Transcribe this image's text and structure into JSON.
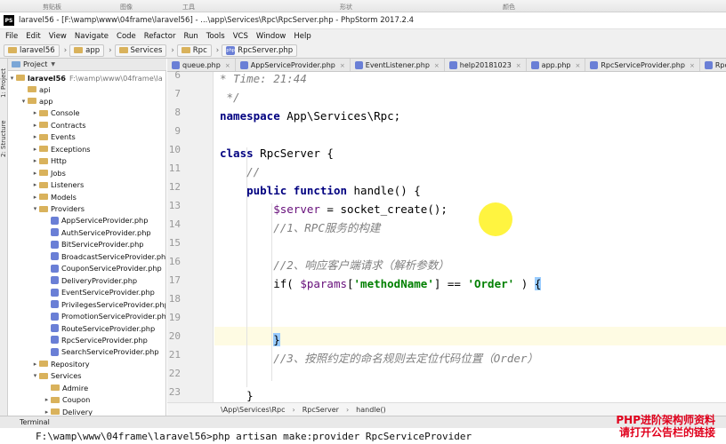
{
  "top_strip": [
    "剪贴板",
    "图像",
    "工具",
    "形状",
    "颜色"
  ],
  "window": {
    "title": "laravel56 - [F:\\wamp\\www\\04frame\\laravel56] - ...\\app\\Services\\Rpc\\RpcServer.php - PhpStorm 2017.2.4",
    "app_icon": "PS"
  },
  "menu": [
    "File",
    "Edit",
    "View",
    "Navigate",
    "Code",
    "Refactor",
    "Run",
    "Tools",
    "VCS",
    "Window",
    "Help"
  ],
  "nav": [
    "laravel56",
    "app",
    "Services",
    "Rpc",
    "RpcServer.php"
  ],
  "side_tabs": [
    "1: Project",
    "2: Structure"
  ],
  "project": {
    "header": "Project",
    "root_name": "laravel56",
    "root_path": "F:\\wamp\\www\\04frame\\la",
    "items": [
      {
        "label": "api",
        "level": 1,
        "type": "folder",
        "arrow": ""
      },
      {
        "label": "app",
        "level": 1,
        "type": "folder",
        "arrow": "▾"
      },
      {
        "label": "Console",
        "level": 2,
        "type": "folder",
        "arrow": "▸"
      },
      {
        "label": "Contracts",
        "level": 2,
        "type": "folder",
        "arrow": "▸"
      },
      {
        "label": "Events",
        "level": 2,
        "type": "folder",
        "arrow": "▸"
      },
      {
        "label": "Exceptions",
        "level": 2,
        "type": "folder",
        "arrow": "▸"
      },
      {
        "label": "Http",
        "level": 2,
        "type": "folder",
        "arrow": "▸"
      },
      {
        "label": "Jobs",
        "level": 2,
        "type": "folder",
        "arrow": "▸"
      },
      {
        "label": "Listeners",
        "level": 2,
        "type": "folder",
        "arrow": "▸"
      },
      {
        "label": "Models",
        "level": 2,
        "type": "folder",
        "arrow": "▸"
      },
      {
        "label": "Providers",
        "level": 2,
        "type": "folder",
        "arrow": "▾"
      },
      {
        "label": "AppServiceProvider.php",
        "level": 3,
        "type": "file",
        "arrow": ""
      },
      {
        "label": "AuthServiceProvider.php",
        "level": 3,
        "type": "file",
        "arrow": ""
      },
      {
        "label": "BitServiceProvider.php",
        "level": 3,
        "type": "file",
        "arrow": ""
      },
      {
        "label": "BroadcastServiceProvider.php",
        "level": 3,
        "type": "file",
        "arrow": ""
      },
      {
        "label": "CouponServiceProvider.php",
        "level": 3,
        "type": "file",
        "arrow": ""
      },
      {
        "label": "DeliveryProvider.php",
        "level": 3,
        "type": "file",
        "arrow": ""
      },
      {
        "label": "EventServiceProvider.php",
        "level": 3,
        "type": "file",
        "arrow": ""
      },
      {
        "label": "PrivilegesServiceProvider.php",
        "level": 3,
        "type": "file",
        "arrow": ""
      },
      {
        "label": "PromotionServiceProvider.php",
        "level": 3,
        "type": "file",
        "arrow": ""
      },
      {
        "label": "RouteServiceProvider.php",
        "level": 3,
        "type": "file",
        "arrow": ""
      },
      {
        "label": "RpcServiceProvider.php",
        "level": 3,
        "type": "file",
        "arrow": ""
      },
      {
        "label": "SearchServiceProvider.php",
        "level": 3,
        "type": "file",
        "arrow": ""
      },
      {
        "label": "Repository",
        "level": 2,
        "type": "folder",
        "arrow": "▸"
      },
      {
        "label": "Services",
        "level": 2,
        "type": "folder",
        "arrow": "▾"
      },
      {
        "label": "Admire",
        "level": 3,
        "type": "folder",
        "arrow": ""
      },
      {
        "label": "Coupon",
        "level": 3,
        "type": "folder",
        "arrow": "▸"
      },
      {
        "label": "Delivery",
        "level": 3,
        "type": "folder",
        "arrow": "▸"
      }
    ]
  },
  "tabs": [
    "queue.php",
    "AppServiceProvider.php",
    "EventListener.php",
    "help20181023",
    "app.php",
    "RpcServiceProvider.php",
    "Rpc.php"
  ],
  "line_numbers": [
    "6",
    "7",
    "8",
    "9",
    "10",
    "11",
    "12",
    "13",
    "14",
    "15",
    "16",
    "17",
    "18",
    "19",
    "20",
    "21",
    "22",
    "23"
  ],
  "code": [
    [
      {
        "t": "* Time: 21:44",
        "c": "cm"
      }
    ],
    [
      {
        "t": " */",
        "c": "cm"
      }
    ],
    [
      {
        "t": "namespace",
        "c": "kw"
      },
      {
        "t": " App\\Services\\Rpc;",
        "c": ""
      }
    ],
    [],
    [
      {
        "t": "class",
        "c": "kw"
      },
      {
        "t": " RpcServer {",
        "c": ""
      }
    ],
    [
      {
        "t": "    //",
        "c": "cm"
      }
    ],
    [
      {
        "t": "    ",
        "c": ""
      },
      {
        "t": "public function",
        "c": "kw"
      },
      {
        "t": " handle() {",
        "c": ""
      }
    ],
    [
      {
        "t": "        ",
        "c": ""
      },
      {
        "t": "$server",
        "c": "var"
      },
      {
        "t": " = socket_create();",
        "c": ""
      }
    ],
    [
      {
        "t": "        //1、RPC服务的构建",
        "c": "cm"
      }
    ],
    [],
    [
      {
        "t": "        //2、响应客户端请求（解析参数）",
        "c": "cm"
      }
    ],
    [
      {
        "t": "        if( ",
        "c": ""
      },
      {
        "t": "$params",
        "c": "var"
      },
      {
        "t": "[",
        "c": ""
      },
      {
        "t": "'methodName'",
        "c": "str"
      },
      {
        "t": "] == ",
        "c": ""
      },
      {
        "t": "'Order'",
        "c": "str"
      },
      {
        "t": " ) ",
        "c": ""
      },
      {
        "t": "{",
        "c": "bm"
      }
    ],
    [],
    [],
    [
      {
        "t": "        ",
        "c": ""
      },
      {
        "t": "}",
        "c": "bm"
      }
    ],
    [
      {
        "t": "        //3、按照约定的命名规则去定位代码位置（Order）",
        "c": "cm"
      }
    ],
    [],
    [
      {
        "t": "    }",
        "c": ""
      }
    ]
  ],
  "breadcrumb": [
    "\\App\\Services\\Rpc",
    "RpcServer",
    "handle()"
  ],
  "terminal": {
    "title": "Terminal",
    "command": "F:\\wamp\\www\\04frame\\laravel56>php artisan make:provider RpcServiceProvider"
  },
  "watermark": [
    "PHP进阶架构师资料",
    "请打开公告栏的链接"
  ]
}
